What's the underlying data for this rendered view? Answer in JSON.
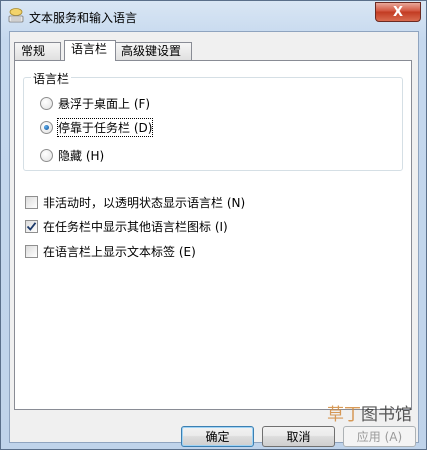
{
  "window": {
    "title": "文本服务和输入语言",
    "close_label": "X"
  },
  "tabs": [
    {
      "label": "常规",
      "active": false
    },
    {
      "label": "语言栏",
      "active": true
    },
    {
      "label": "高级键设置",
      "active": false
    }
  ],
  "language_bar_group": {
    "legend": "语言栏",
    "options": [
      {
        "label": "悬浮于桌面上 (F)",
        "checked": false
      },
      {
        "label": "停靠于任务栏 (D)",
        "checked": true
      },
      {
        "label": "隐藏 (H)",
        "checked": false
      }
    ]
  },
  "checkboxes": [
    {
      "label": "非活动时，以透明状态显示语言栏 (N)",
      "checked": false
    },
    {
      "label": "在任务栏中显示其他语言栏图标 (I)",
      "checked": true
    },
    {
      "label": "在语言栏上显示文本标签 (E)",
      "checked": false
    }
  ],
  "buttons": {
    "ok": "确定",
    "cancel": "取消",
    "apply": "应用 (A)"
  },
  "watermark": {
    "part1": "草丁",
    "part2": "图书馆"
  }
}
